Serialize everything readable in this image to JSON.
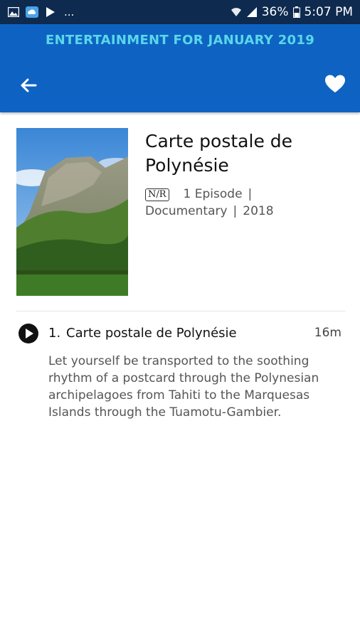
{
  "status_bar": {
    "more": "...",
    "battery": "36%",
    "time": "5:07 PM"
  },
  "header": {
    "title": "ENTERTAINMENT FOR JANUARY 2019"
  },
  "show": {
    "title": "Carte postale de Polynésie",
    "rating": "N/R",
    "episodes": "1 Episode",
    "separator": "|",
    "genre": "Documentary",
    "year": "2018"
  },
  "episode": {
    "number": "1.",
    "title": "Carte postale de Polynésie",
    "duration": "16m",
    "description": "Let yourself be transported to the soothing rhythm of a postcard through the Polynesian archipelagoes from Tahiti to the Marquesas Islands through the Tuamotu-Gambier."
  },
  "colors": {
    "status_bar": "#0e2a4f",
    "header": "#0e63c2",
    "header_title": "#5ad7ea"
  },
  "icons": {
    "back": "arrow-left-icon",
    "favorite": "heart-icon",
    "play": "play-icon"
  }
}
